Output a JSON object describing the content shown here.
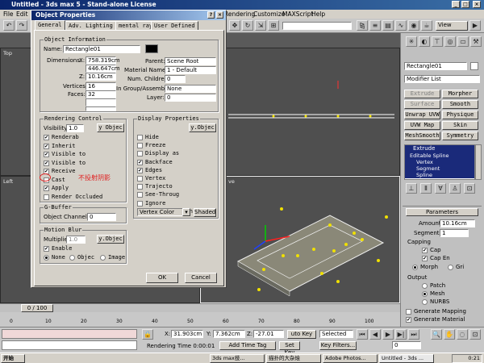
{
  "window": {
    "title": "Untitled - 3ds max 5 - Stand-alone License"
  },
  "menu": [
    "File",
    "Edit",
    "I",
    "Rendering",
    "Customize",
    "MAXScript",
    "Help"
  ],
  "viewports": {
    "top": "Top",
    "left": "Left",
    "persp_tail": "ve",
    "view_dropdown": "View"
  },
  "dialog": {
    "title": "Object Properties",
    "tabs": [
      "General",
      "Adv. Lighting",
      "mental ray",
      "User Defined"
    ],
    "object_info": {
      "heading": "Object Information",
      "name_label": "Name:",
      "name": "Rectangle01",
      "dimensions_label": "Dimensions:",
      "dim_x_label": "X:",
      "dim_x": "758.319cm",
      "dim_y": "446.647cm",
      "dim_z_label": "Z:",
      "dim_z": "10.16cm",
      "vertices_label": "Vertices:",
      "vertices": "16",
      "faces_label": "Faces:",
      "faces": "32",
      "parent_label": "Parent:",
      "parent": "Scene Root",
      "material_label": "Material Name:",
      "material": "1 - Default",
      "children_label": "Num. Children:",
      "children": "0",
      "group_label": "In Group/Assembly:",
      "group": "None",
      "layer_label": "Layer:",
      "layer": "0"
    },
    "rendering": {
      "heading": "Rendering Control",
      "visibility_label": "Visibility:",
      "visibility": "1.0",
      "byobj": "y Objec",
      "items": [
        {
          "label": "Renderab",
          "checked": true
        },
        {
          "label": "Inherit",
          "checked": true
        },
        {
          "label": "Visible to",
          "checked": true
        },
        {
          "label": "Visible to",
          "checked": true
        },
        {
          "label": "Receive",
          "checked": true
        },
        {
          "label": "Cast",
          "checked": false
        },
        {
          "label": "Apply",
          "checked": true
        },
        {
          "label": "Render Occluded",
          "checked": false
        }
      ],
      "annotation": "不投射阴影"
    },
    "display": {
      "heading": "Display Properties",
      "byobj": "y.Objec",
      "items": [
        {
          "label": "Hide",
          "checked": false
        },
        {
          "label": "Freeze",
          "checked": false
        },
        {
          "label": "Display as",
          "checked": false
        },
        {
          "label": "Backface",
          "checked": true
        },
        {
          "label": "Edges",
          "checked": true
        },
        {
          "label": "Vertex",
          "checked": false
        },
        {
          "label": "Trajecto",
          "checked": false
        },
        {
          "label": "See-Throug",
          "checked": false
        },
        {
          "label": "Ignore",
          "checked": false
        },
        {
          "label": "Show Frozen in",
          "checked": true
        }
      ],
      "vertex_color": "Vertex Color",
      "shaded": "Shaded"
    },
    "gbuffer": {
      "heading": "G-Buffer",
      "channel_label": "Object Channel:",
      "channel": "0"
    },
    "motion_blur": {
      "heading": "Motion Blur",
      "multiplier_label": "Multiplier:",
      "multiplier": "1.0",
      "byobj": "y.Objec",
      "enabled_label": "Enable",
      "options": [
        "None",
        "Objec",
        "Image"
      ]
    },
    "ok": "OK",
    "cancel": "Cancel"
  },
  "command_panel": {
    "object_name": "Rectangle01",
    "modifier_list": "Modifier List",
    "modifier_buttons": [
      "Extrude",
      "Morpher",
      "Surface",
      "Smooth",
      "Unwrap UVW",
      "Physique",
      "UVW Map",
      "Skin",
      "MeshSmooth",
      "Symmetry"
    ],
    "stack": [
      "Extrude",
      "Editable Spline",
      "Vertex",
      "Segment",
      "Spline"
    ],
    "parameters": {
      "heading": "Parameters",
      "amount_label": "Amount:",
      "amount": "10.16cm",
      "segments_label": "Segments:",
      "segments": "1",
      "capping": "Capping",
      "cap_start": "Cap",
      "cap_end": "Cap En",
      "morph": "Morph",
      "grid": "Gri",
      "output": "Output",
      "patch": "Patch",
      "mesh": "Mesh",
      "nurbs": "NURBS",
      "gen_mapping": "Generate Mapping",
      "gen_material": "Generate Material"
    }
  },
  "timeline": {
    "frame": "0 / 100"
  },
  "ruler": [
    "0",
    "10",
    "20",
    "30",
    "40",
    "50",
    "60",
    "70",
    "80",
    "90",
    "100"
  ],
  "status": {
    "x_label": "X:",
    "x": "31.903cm",
    "y_label": "Y:",
    "y": "7.362cm",
    "z_label": "Z:",
    "z": "-27.01",
    "auto_key": "uto Key",
    "selected": "Selected",
    "set_key": "Set Key",
    "key_filters": "Key Filters...",
    "render_time": "Rendering Time  0:00:01",
    "add_time_tag": "Add Time Tag",
    "frame": "0"
  },
  "taskbar": {
    "start": "开始",
    "tasks": [
      "3ds max技...",
      "描扑的大杂烩",
      "Adobe Photos...",
      "Untitled - 3ds ..."
    ],
    "clock": "0:21"
  }
}
